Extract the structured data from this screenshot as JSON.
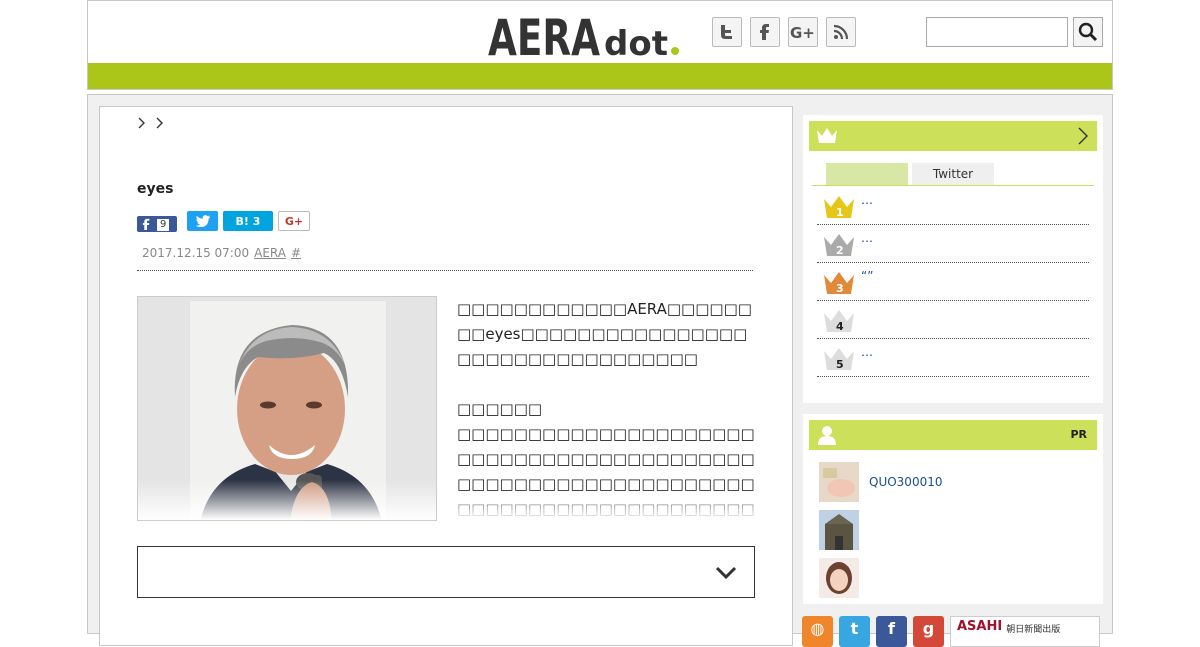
{
  "header": {
    "logo_text_main": "AERA",
    "logo_text_sub": "dot",
    "social_icons": [
      "twitter-icon",
      "facebook-icon",
      "google-plus-icon",
      "rss-icon"
    ],
    "search_placeholder": "",
    "accent_color": "#acc519"
  },
  "article": {
    "title": "eyes",
    "share": {
      "facebook_count": "9",
      "hatena_label": "B!",
      "hatena_count": "3",
      "gplus_label": "G+"
    },
    "date": "2017.12.15 07:00",
    "source": "AERA",
    "tag": "#",
    "paragraphs": [
      "□□□□□□□□□□□□AERA□□□□□□□□eyes□□□□□□□□□□□□□□□□□□□□□□□□□□□□□□□□□",
      "□□□□□□",
      "□□□□□□□□□□□□□□□□□□□□□□□□□□□□□□□□□□□□□□□□□□□□□□□□□□□□□□□□□□□□□□□□□□□□□□□□□□□□□□□□□□□□□□□□□□□□□□□□□□□□□□□□□□□□□□□□□□□□□□□□□□□□□□□□□□□"
    ]
  },
  "sidebar": {
    "ranking": {
      "tabs": [
        "",
        "Twitter"
      ],
      "items": [
        {
          "rank": "1",
          "text": "…",
          "color": "#e6c619"
        },
        {
          "rank": "2",
          "text": "…",
          "color": "#aaaaaa"
        },
        {
          "rank": "3",
          "text": "“”",
          "color": "#e08b3a"
        },
        {
          "rank": "4",
          "text": "",
          "color": "#dddddd"
        },
        {
          "rank": "5",
          "text": "…",
          "color": "#dddddd"
        }
      ]
    },
    "pr": {
      "label": "PR",
      "items": [
        {
          "text": "QUO300010"
        },
        {
          "text": ""
        },
        {
          "text": ""
        }
      ]
    }
  },
  "footer_badges": {
    "asahi_label": "ASAHI",
    "asahi_sub": "朝日新聞出版"
  }
}
